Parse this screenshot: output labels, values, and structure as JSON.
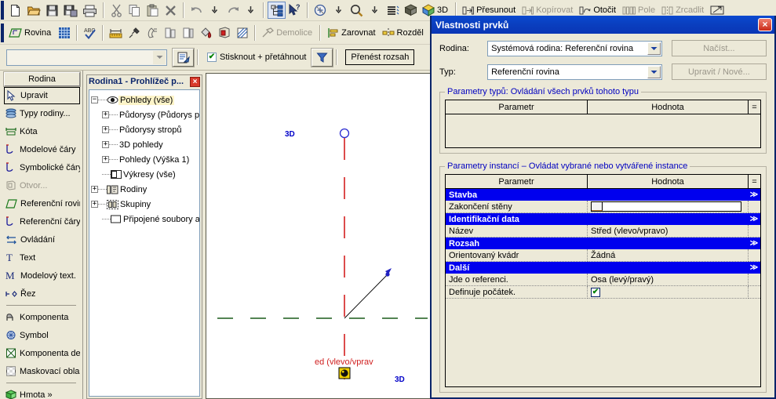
{
  "toolbars": {
    "row1": {
      "icons_left": [
        "new-file-icon",
        "open-folder-icon",
        "save-icon",
        "save-all-icon",
        "print-icon"
      ],
      "icons_edit": [
        "cut-icon",
        "copy-icon",
        "paste-icon",
        "delete-x-icon"
      ],
      "icons_undo": [
        "undo-icon",
        "undo-dropdown-icon",
        "redo-icon",
        "redo-dropdown-icon"
      ],
      "icons_view": [
        "properties-tree-icon",
        "context-help-icon"
      ],
      "icons_zoom": [
        "zoom-region-icon",
        "zoom-dropdown-icon",
        "magnifier-icon",
        "magnifier-dropdown-icon",
        "thin-lines-icon",
        "default-3d-view-icon"
      ],
      "view3d_label": "3D",
      "modify_buttons": [
        {
          "label": "Přesunout",
          "icon": "move-icon",
          "disabled": false
        },
        {
          "label": "Kopírovat",
          "icon": "copy-element-icon",
          "disabled": true
        },
        {
          "label": "Otočit",
          "icon": "rotate-icon",
          "disabled": false
        },
        {
          "label": "Pole",
          "icon": "array-icon",
          "disabled": true
        },
        {
          "label": "Zrcadlit",
          "icon": "mirror-icon",
          "disabled": true
        }
      ],
      "last_icon": "resize-icon"
    },
    "row2": {
      "plane_label": "Rovina",
      "plane_icon": "work-plane-icon",
      "icons_a": [
        "grid-icon",
        "spell-check-icon"
      ],
      "icons_b": [
        "tape-measure-icon",
        "eyedropper-icon",
        "paint-icon",
        "split-face-icon",
        "wall-opening-icon",
        "paint-bucket-icon",
        "model-box-icon",
        "hatch-icon"
      ],
      "demolish": {
        "label": "Demolice",
        "icon": "hammer-icon",
        "disabled": true
      },
      "align": {
        "label": "Zarovnat",
        "icon": "align-icon"
      },
      "split": {
        "label": "Rozděl",
        "icon": "split-icon"
      }
    },
    "row3": {
      "type_selector_value": "",
      "type_selector_placeholder": "",
      "properties_icon": "element-properties-icon",
      "press_drag_label": "Stisknout + přetáhnout",
      "press_drag_checked": true,
      "filter_icon": "filter-funnel-icon",
      "extend_label": "Přenést rozsah"
    }
  },
  "designbar": {
    "header": "Rodina",
    "items": [
      {
        "label": "Upravit",
        "icon": "arrow-cursor-icon",
        "selected": true,
        "disabled": false
      },
      {
        "label": "Typy rodiny...",
        "icon": "family-types-icon",
        "selected": false,
        "disabled": false
      },
      {
        "label": "Kóta",
        "icon": "dimension-icon",
        "selected": false,
        "disabled": false
      },
      {
        "label": "Modelové čáry",
        "icon": "model-lines-icon",
        "selected": false,
        "disabled": false
      },
      {
        "label": "Symbolické čáry",
        "icon": "symbolic-lines-icon",
        "selected": false,
        "disabled": false
      },
      {
        "label": "Otvor...",
        "icon": "opening-icon",
        "selected": false,
        "disabled": true
      },
      {
        "label": "Referenční rovina",
        "icon": "reference-plane-icon",
        "selected": false,
        "disabled": false
      },
      {
        "label": "Referenční čáry",
        "icon": "reference-lines-icon",
        "selected": false,
        "disabled": false
      },
      {
        "label": "Ovládání",
        "icon": "control-icon",
        "selected": false,
        "disabled": false
      },
      {
        "label": "Text",
        "icon": "text-icon",
        "selected": false,
        "disabled": false
      },
      {
        "label": "Modelový text.",
        "icon": "model-text-icon",
        "selected": false,
        "disabled": false
      },
      {
        "label": "Řez",
        "icon": "section-icon",
        "selected": false,
        "disabled": false
      },
      {
        "label": "Komponenta",
        "icon": "component-icon",
        "selected": false,
        "disabled": false
      },
      {
        "label": "Symbol",
        "icon": "symbol-icon",
        "selected": false,
        "disabled": false
      },
      {
        "label": "Komponenta detailu",
        "icon": "detail-component-icon",
        "selected": false,
        "disabled": false
      },
      {
        "label": "Maskovací oblast",
        "icon": "masking-region-icon",
        "selected": false,
        "disabled": false
      },
      {
        "label": "Hmota »",
        "icon": "mass-icon",
        "selected": false,
        "disabled": false
      }
    ]
  },
  "browser": {
    "title": "Rodina1 - Prohlížeč p...",
    "close_label": "×",
    "tree": [
      {
        "label": "Pohledy (vše)",
        "icon": "eye-icon",
        "indent": 0,
        "expander": "-",
        "selected": true
      },
      {
        "label": "Půdorysy (Půdorys p",
        "icon": "none",
        "indent": 1,
        "expander": "+",
        "selected": false
      },
      {
        "label": "Půdorysy stropů",
        "icon": "none",
        "indent": 1,
        "expander": "+",
        "selected": false
      },
      {
        "label": "3D pohledy",
        "icon": "none",
        "indent": 1,
        "expander": "+",
        "selected": false
      },
      {
        "label": "Pohledy (Výška 1)",
        "icon": "none",
        "indent": 1,
        "expander": "+",
        "selected": false
      },
      {
        "label": "Výkresy (vše)",
        "icon": "sheet-icon",
        "indent": 1,
        "expander": "",
        "selected": false
      },
      {
        "label": "Rodiny",
        "icon": "families-icon",
        "indent": 0,
        "expander": "+",
        "selected": false
      },
      {
        "label": "Skupiny",
        "icon": "groups-icon",
        "indent": 0,
        "expander": "+",
        "selected": false
      },
      {
        "label": "Připojené soubory ap",
        "icon": "linked-files-icon",
        "indent": 1,
        "expander": "",
        "selected": false
      }
    ]
  },
  "canvas": {
    "labels_3d": [
      "3D",
      "3D"
    ],
    "reference_plane_name": "ed (vlevo/vprav",
    "colors": {
      "vertical_ref_plane": "#d42020",
      "horizontal_ref_plane": "#1a5c1a",
      "label_3d": "#0000c8",
      "ref_name_text": "#d02020"
    }
  },
  "dialog": {
    "title": "Vlastnosti prvků",
    "close_label": "×",
    "family": {
      "label": "Rodina:",
      "value": "Systémová rodina: Referenční rovina",
      "button": "Načíst..."
    },
    "type": {
      "label": "Typ:",
      "value": "Referenční rovina",
      "button": "Upravit / Nové..."
    },
    "type_params": {
      "legend": "Parametry typů: Ovládání všech prvků tohoto typu",
      "columns": [
        "Parametr",
        "Hodnota",
        "="
      ],
      "rows": []
    },
    "instance_params": {
      "legend": "Parametry instancí – Ovládat vybrané nebo vytvářené instance",
      "columns": [
        "Parametr",
        "Hodnota",
        "="
      ],
      "groups": [
        {
          "name": "Stavba",
          "collapse_icon": "≫",
          "rows": [
            {
              "param": "Zakončení stěny",
              "value": "",
              "type": "input"
            }
          ]
        },
        {
          "name": "Identifikační data",
          "collapse_icon": "≫",
          "rows": [
            {
              "param": "Název",
              "value": "Střed (vlevo/vpravo)",
              "type": "text"
            }
          ]
        },
        {
          "name": "Rozsah",
          "collapse_icon": "≫",
          "rows": [
            {
              "param": "Orientovaný kvádr",
              "value": "Žádná",
              "type": "text"
            }
          ]
        },
        {
          "name": "Další",
          "collapse_icon": "≫",
          "rows": [
            {
              "param": "Jde o referenci.",
              "value": "Osa (levý/pravý)",
              "type": "text"
            },
            {
              "param": "Definuje počátek.",
              "value": "✔",
              "type": "checkbox"
            }
          ]
        }
      ]
    }
  }
}
